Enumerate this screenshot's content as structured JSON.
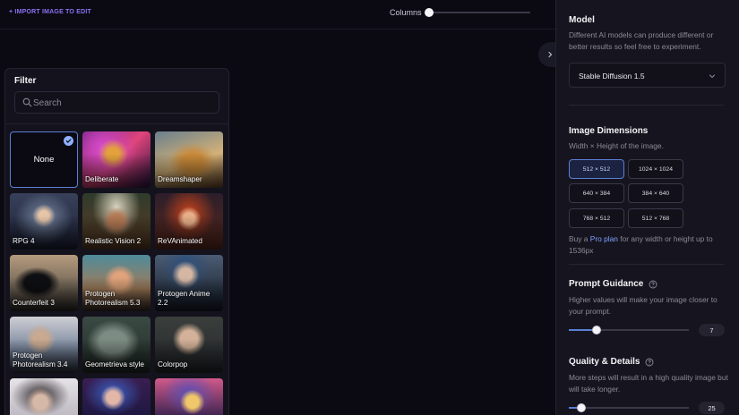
{
  "topbar": {
    "import_label": "+ IMPORT IMAGE TO EDIT",
    "columns_label": "Columns",
    "columns_value_fraction": 0.02
  },
  "filter": {
    "title": "Filter",
    "search_placeholder": "Search",
    "search_value": "",
    "tiles": [
      {
        "label": "None",
        "selected": true
      },
      {
        "label": "Deliberate"
      },
      {
        "label": "Dreamshaper"
      },
      {
        "label": "RPG 4"
      },
      {
        "label": "Realistic Vision 2"
      },
      {
        "label": "ReVAnimated"
      },
      {
        "label": "Counterfeit 3"
      },
      {
        "label": "Protogen Photorealism 5.3"
      },
      {
        "label": "Protogen Anime 2.2"
      },
      {
        "label": "Protogen Photorealism 3.4"
      },
      {
        "label": "Geometrieva style"
      },
      {
        "label": "Colorpop"
      },
      {
        "label": ""
      },
      {
        "label": ""
      },
      {
        "label": ""
      }
    ]
  },
  "model": {
    "title": "Model",
    "description": "Different AI models can produce different or better results so feel free to experiment.",
    "selected": "Stable Diffusion 1.5"
  },
  "dimensions": {
    "title": "Image Dimensions",
    "description": "Width × Height of the image.",
    "options": [
      "512 × 512",
      "1024 × 1024",
      "640 × 384",
      "384 × 640",
      "768 × 512",
      "512 × 768"
    ],
    "selected_index": 0,
    "upsell_before": "Buy a ",
    "upsell_link": "Pro plan",
    "upsell_after": " for any width or height up to 1536px"
  },
  "prompt_guidance": {
    "title": "Prompt Guidance",
    "description": "Higher values will make your image closer to your prompt.",
    "value": "7"
  },
  "quality": {
    "title": "Quality & Details",
    "description": "More steps will result in a high quality image but will take longer.",
    "value": "25"
  },
  "colors": {
    "accent": "#5b7fd6",
    "import_link": "#8b72f5",
    "pro_link": "#7fa0ff",
    "background": "#0b0a13",
    "panel": "#16151f"
  },
  "icons": [
    "search-icon",
    "chevron-right-icon",
    "chevron-down-icon",
    "check-icon",
    "help-circle-icon"
  ]
}
